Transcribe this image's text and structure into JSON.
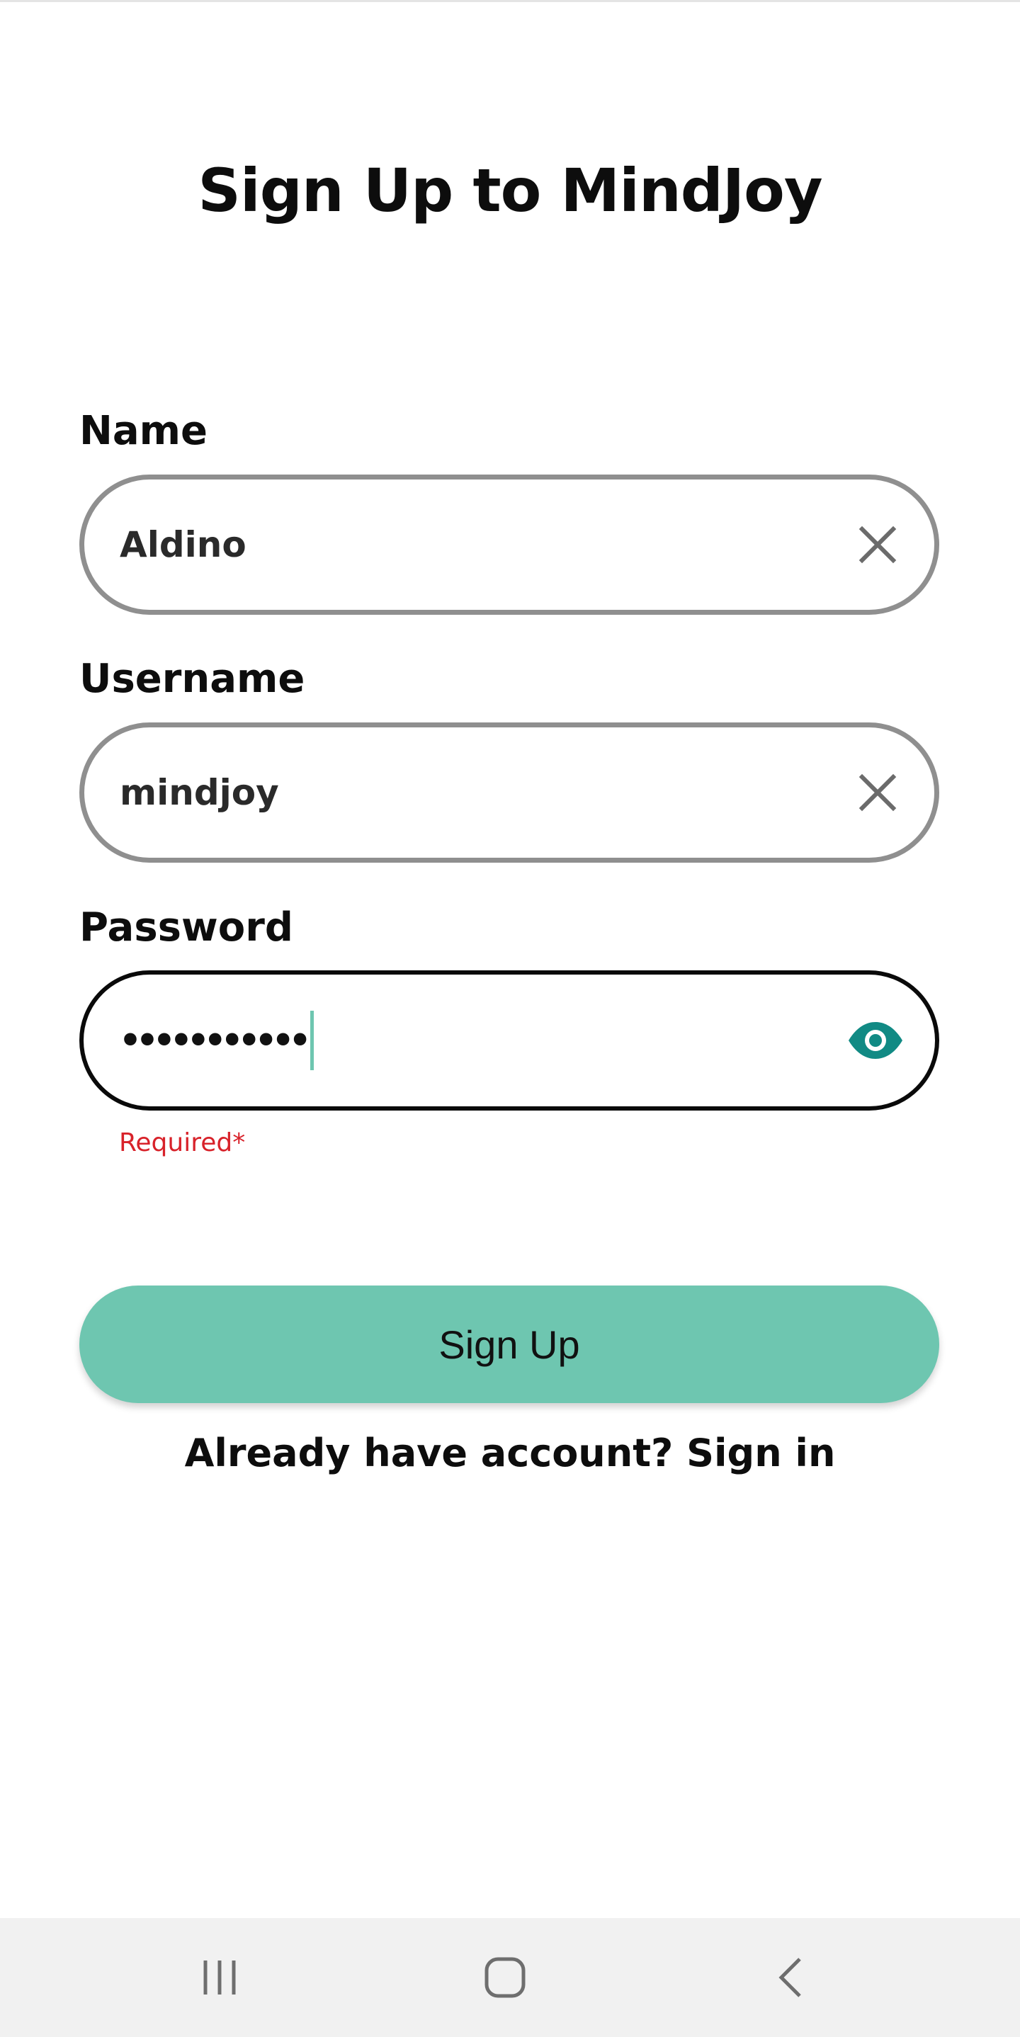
{
  "page": {
    "title": "Sign Up to MindJoy"
  },
  "form": {
    "name": {
      "label": "Name",
      "value": "Aldino",
      "clear_icon": "close-icon"
    },
    "username": {
      "label": "Username",
      "value": "mindjoy",
      "clear_icon": "close-icon"
    },
    "password": {
      "label": "Password",
      "masked_value": "•••••••••••",
      "visibility_icon": "eye-icon",
      "error": "Required*"
    }
  },
  "actions": {
    "signup_label": "Sign Up",
    "signin_text": "Already have account? Sign in"
  },
  "navigation_bar": {
    "buttons": [
      "recent-apps-icon",
      "home-icon",
      "back-icon"
    ]
  },
  "colors": {
    "accent": "#6ec6b0",
    "icon_teal": "#118a84",
    "error": "#d8222a",
    "field_border": "#8f8f8f",
    "focused_border": "#0a0a0a",
    "nav_background": "#f1f1f1"
  }
}
